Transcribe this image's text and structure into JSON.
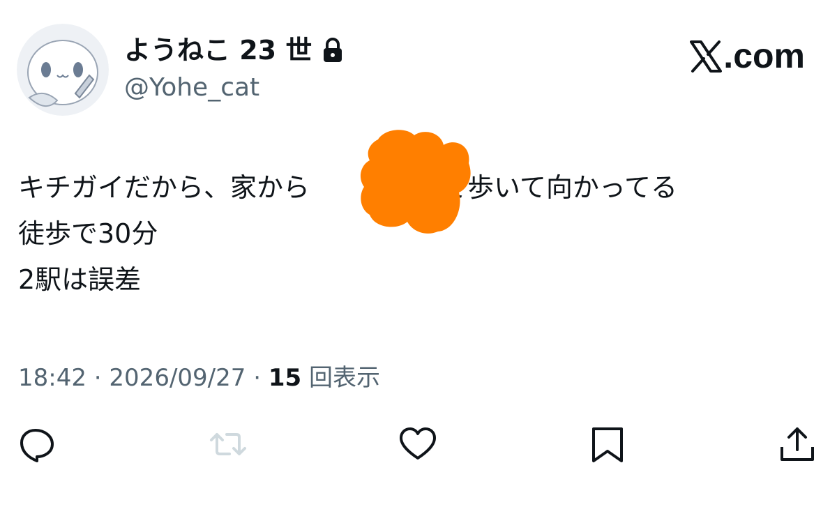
{
  "user": {
    "display_name": "ようねこ 23 世",
    "handle": "@Yohe_cat",
    "avatar_icon": "avatar-character-icon",
    "protected_icon": "lock-icon"
  },
  "brand": {
    "logo_icon": "x-logo-icon",
    "label": ".com"
  },
  "tweet": {
    "line1_before": "キチガイだから、家から",
    "line1_after": "まで歩いて向かってる",
    "line2": "徒歩で30分",
    "line3": "2駅は誤差",
    "redaction_color": "#ff7f00"
  },
  "meta": {
    "time": "18:42",
    "separator1": " · ",
    "date": "2026/09/27",
    "separator2": " · ",
    "views_count": "15",
    "views_label": " 回表示"
  },
  "actions": {
    "reply_icon": "reply-icon",
    "retweet_icon": "retweet-icon",
    "like_icon": "heart-icon",
    "bookmark_icon": "bookmark-icon",
    "share_icon": "share-icon"
  },
  "colors": {
    "text": "#0f1419",
    "secondary": "#536471",
    "retweet_disabled": "#cfd9de",
    "redaction": "#ff7f00"
  }
}
